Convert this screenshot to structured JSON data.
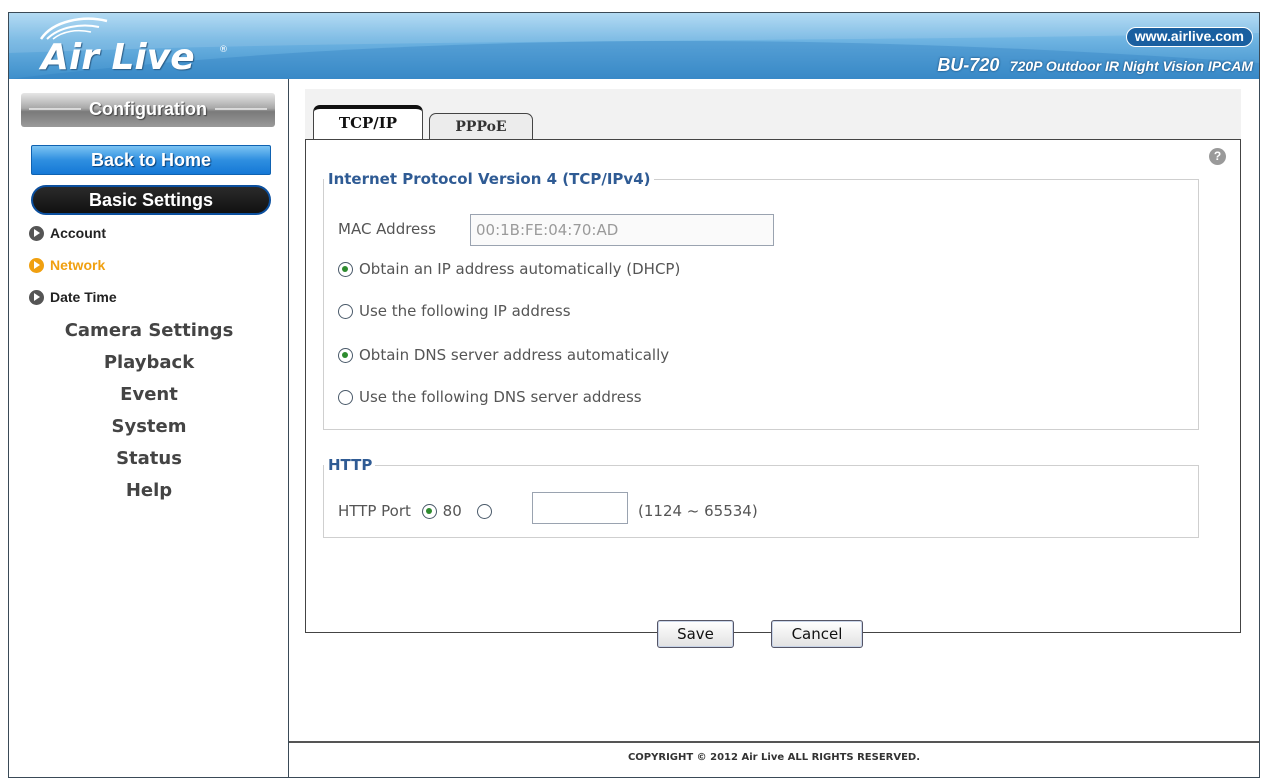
{
  "header": {
    "logo_text": "Air Live",
    "logo_mark": "®",
    "url": "www.airlive.com",
    "model": "BU-720",
    "model_desc": "720P Outdoor IR Night Vision IPCAM",
    "brand_color": "#3e8fcb"
  },
  "sidebar": {
    "config_label": "Configuration",
    "home_label": "Back to Home",
    "basic_label": "Basic Settings",
    "sub_items": [
      {
        "label": "Account",
        "active": false
      },
      {
        "label": "Network",
        "active": true
      },
      {
        "label": "Date Time",
        "active": false
      }
    ],
    "main_items": [
      {
        "label": "Camera Settings"
      },
      {
        "label": "Playback"
      },
      {
        "label": "Event"
      },
      {
        "label": "System"
      },
      {
        "label": "Status"
      },
      {
        "label": "Help"
      }
    ],
    "active_color": "#f0a010"
  },
  "tabs": [
    {
      "label": "TCP/IP",
      "active": true
    },
    {
      "label": "PPPoE",
      "active": false
    }
  ],
  "help_icon": "?",
  "ipv4": {
    "legend": "Internet Protocol Version 4 (TCP/IPv4)",
    "mac_label": "MAC Address",
    "mac_value": "00:1B:FE:04:70:AD",
    "options": [
      {
        "label": "Obtain an IP address automatically (DHCP)",
        "checked": true
      },
      {
        "label": "Use the following IP address",
        "checked": false
      },
      {
        "label": "Obtain DNS server address automatically",
        "checked": true
      },
      {
        "label": "Use the following DNS server address",
        "checked": false
      }
    ]
  },
  "http": {
    "legend": "HTTP",
    "port_label": "HTTP Port",
    "default_port": "80",
    "default_checked": true,
    "custom_value": "",
    "range": "(1124 ~ 65534)"
  },
  "buttons": {
    "save": "Save",
    "cancel": "Cancel"
  },
  "footer": {
    "copyright": "COPYRIGHT © 2012 Air Live ALL RIGHTS RESERVED."
  }
}
